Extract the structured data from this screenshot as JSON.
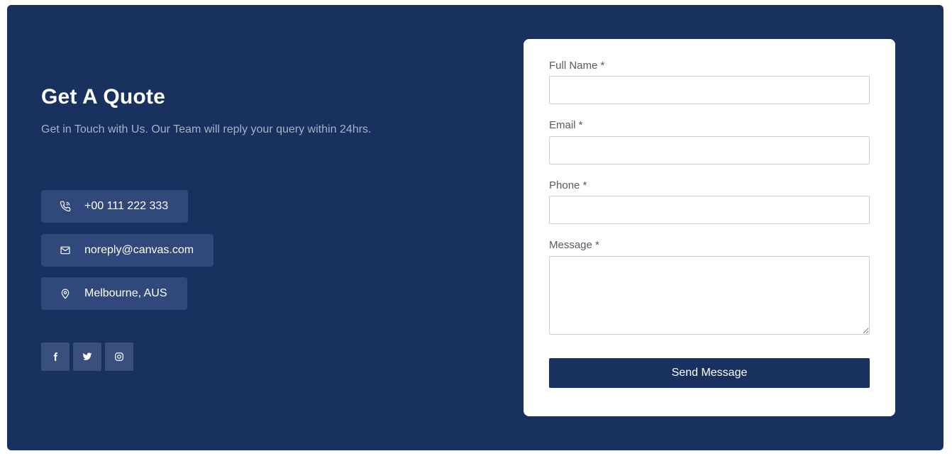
{
  "quote": {
    "title": "Get A Quote",
    "subtitle": "Get in Touch with Us. Our Team will reply your query within 24hrs."
  },
  "contacts": [
    {
      "icon": "phone-icon",
      "text": "+00 111 222 333"
    },
    {
      "icon": "mail-icon",
      "text": "noreply@canvas.com"
    },
    {
      "icon": "location-pin-icon",
      "text": "Melbourne, AUS"
    }
  ],
  "socials": [
    {
      "icon": "facebook-icon"
    },
    {
      "icon": "twitter-icon"
    },
    {
      "icon": "instagram-icon"
    }
  ],
  "form": {
    "full_name_label": "Full Name *",
    "full_name_value": "",
    "email_label": "Email *",
    "email_value": "",
    "phone_label": "Phone *",
    "phone_value": "",
    "message_label": "Message *",
    "message_value": "",
    "submit_label": "Send Message"
  },
  "colors": {
    "panel_bg": "#18315e",
    "chip_bg": "#30487a",
    "social_bg": "#394f7d",
    "button_bg": "#18315e",
    "card_bg": "#ffffff"
  }
}
